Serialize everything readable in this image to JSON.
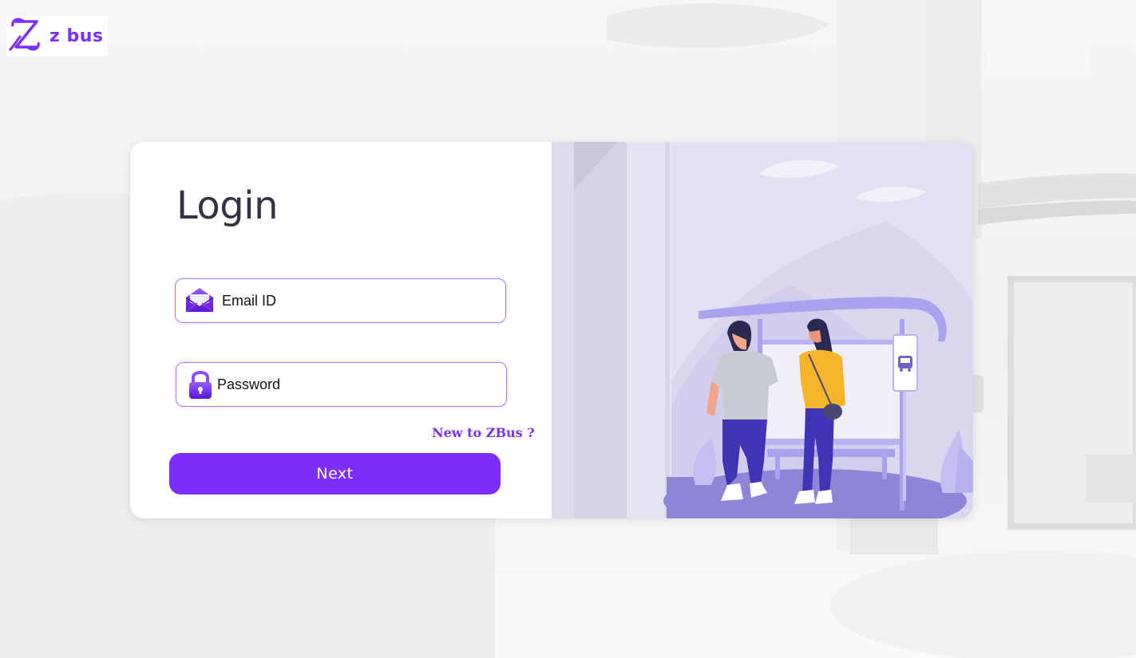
{
  "brand": {
    "name": "z bus",
    "logo_icon": "zbus-logo-icon",
    "accent_color": "#7b2ff7"
  },
  "login": {
    "title": "Login",
    "email": {
      "placeholder": "Email ID",
      "value": "",
      "icon": "envelope-icon"
    },
    "password": {
      "placeholder": "Password",
      "value": "",
      "icon": "lock-icon"
    },
    "signup_link": "New to ZBus ?",
    "next_label": "Next"
  },
  "illustration": {
    "sign_icon": "bus-sign-icon"
  }
}
